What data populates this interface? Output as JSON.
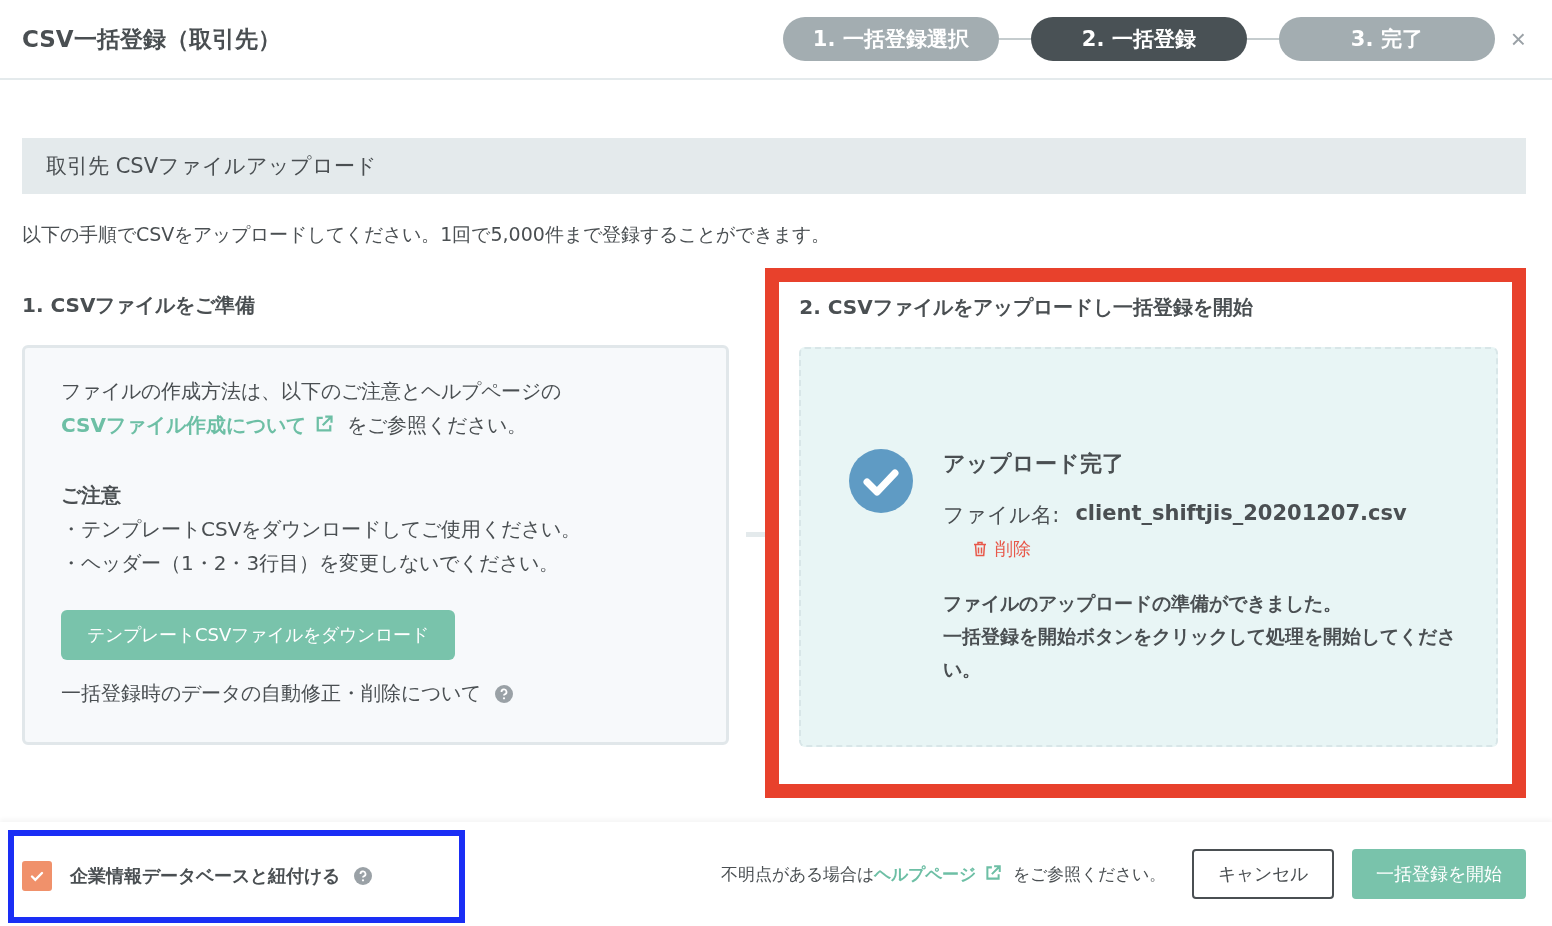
{
  "dialog": {
    "title": "CSV一括登録（取引先）",
    "close": "×",
    "steps": [
      {
        "label": "1. 一括登録選択",
        "selected": false
      },
      {
        "label": "2. 一括登録",
        "selected": true
      },
      {
        "label": "3. 完了",
        "selected": false
      }
    ]
  },
  "section_title": "取引先 CSVファイルアップロード",
  "intro": "以下の手順でCSVをアップロードしてください。1回で5,000件まで登録することができます。",
  "prepare": {
    "heading": "1. CSVファイルをご準備",
    "text_before": "ファイルの作成方法は、以下のご注意とヘルプページの",
    "link": "CSVファイル作成について",
    "text_after": "をご参照ください。",
    "notes_heading": "ご注意",
    "notes": [
      "・テンプレートCSVをダウンロードしてご使用ください。",
      "・ヘッダー（1・2・3行目）を変更しないでください。"
    ],
    "download_button": "テンプレートCSVファイルをダウンロード",
    "auto_fix_label": "一括登録時のデータの自動修正・削除について"
  },
  "upload": {
    "heading": "2. CSVファイルをアップロードし一括登録を開始",
    "status": "アップロード完了",
    "file_label": "ファイル名:",
    "file_name": "client_shiftjis_20201207.csv",
    "delete": "削除",
    "message_lines": [
      "ファイルのアップロードの準備ができました。",
      "一括登録を開始ボタンをクリックして処理を開始してください。"
    ]
  },
  "footer": {
    "link_checkbox": {
      "label": "企業情報データベースと紐付ける",
      "checked": true
    },
    "help_before": "不明点がある場合は",
    "help_link": "ヘルプページ",
    "help_after": "をご参照ください。",
    "cancel": "キャンセル",
    "submit": "一括登録を開始"
  }
}
